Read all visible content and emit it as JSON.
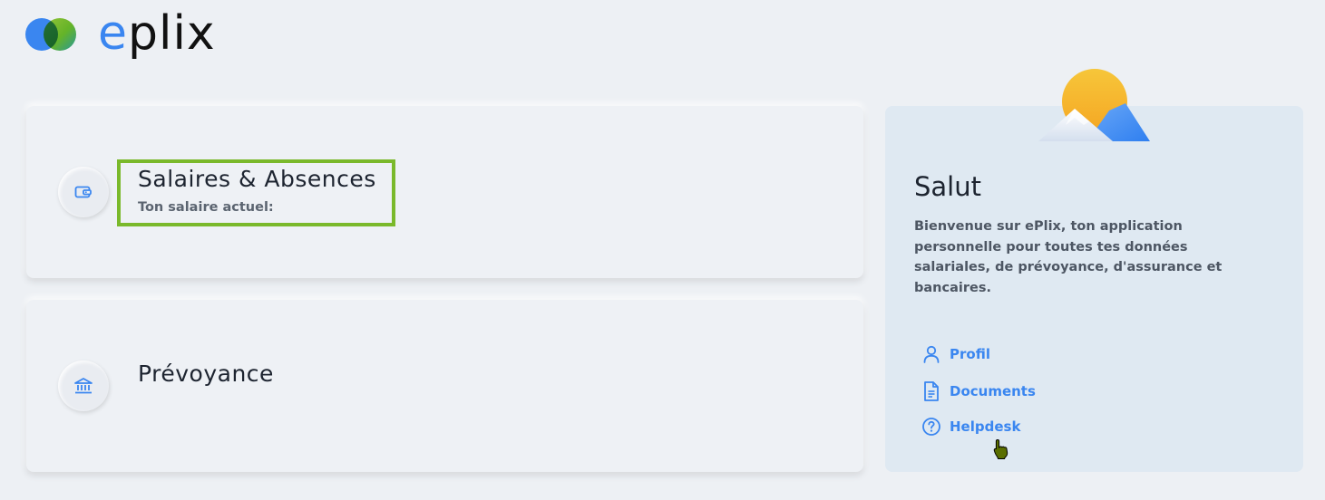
{
  "brand": {
    "logo_text_e": "e",
    "logo_text_rest": "plix",
    "primary_color": "#3a86f0",
    "accent_color": "#7ab92b"
  },
  "cards": {
    "salaires": {
      "title": "Salaires & Absences",
      "subtitle": "Ton salaire actuel:",
      "icon": "wallet-icon"
    },
    "prevoyance": {
      "title": "Prévoyance",
      "icon": "bank-icon"
    }
  },
  "welcome": {
    "title": "Salut",
    "text": "Bienvenue sur ePlix, ton application personnelle pour toutes tes données salariales, de prévoyance, d'assurance et bancaires."
  },
  "links": {
    "profil": {
      "label": "Profil",
      "icon": "user-icon"
    },
    "documents": {
      "label": "Documents",
      "icon": "document-icon"
    },
    "helpdesk": {
      "label": "Helpdesk",
      "icon": "help-icon"
    }
  }
}
